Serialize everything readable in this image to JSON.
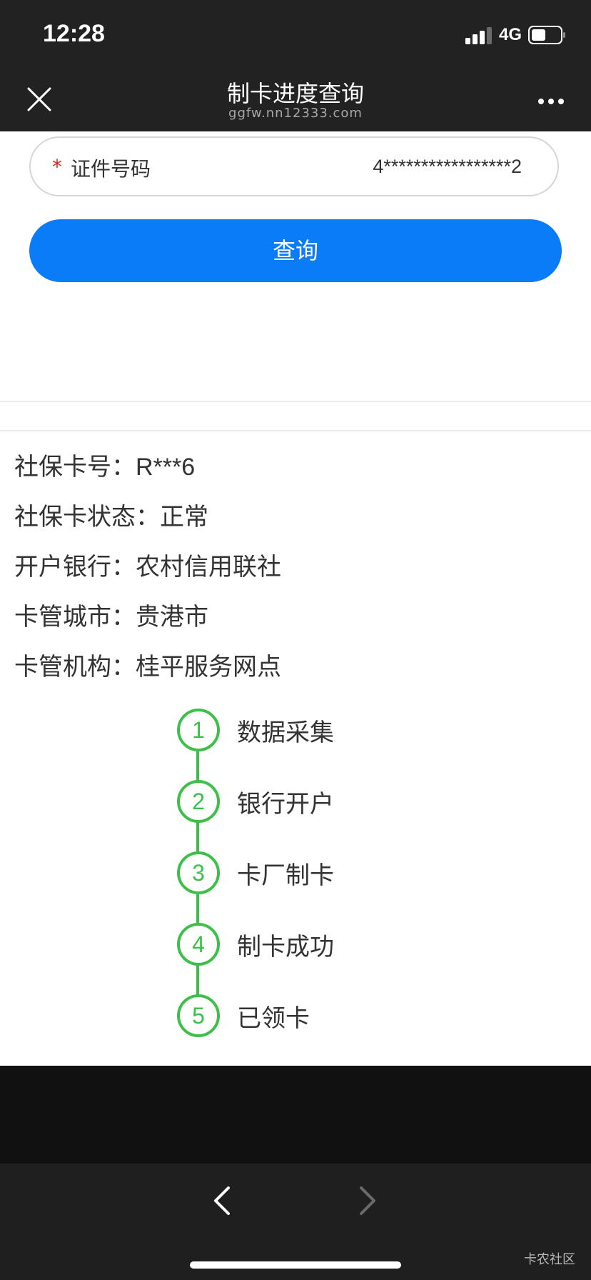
{
  "status_bar": {
    "time": "12:28",
    "network": "4G",
    "icons": [
      "signal-bars-icon",
      "battery-icon"
    ]
  },
  "nav": {
    "title": "制卡进度查询",
    "url": "ggfw.nn12333.com",
    "icons": [
      "close-icon",
      "more-icon"
    ]
  },
  "form": {
    "required_mark": "*",
    "id_label": "证件号码",
    "id_value": "4*****************2",
    "query_button": "查询"
  },
  "info": [
    {
      "label": "社保卡号：",
      "value": "R***6"
    },
    {
      "label": "社保卡状态：",
      "value": "正常"
    },
    {
      "label": "开户银行：",
      "value": "农村信用联社"
    },
    {
      "label": "卡管城市：",
      "value": "贵港市"
    },
    {
      "label": "卡管机构：",
      "value": "桂平服务网点"
    }
  ],
  "progress": {
    "color": "#3cc04a",
    "steps": [
      {
        "number": "1",
        "label": "数据采集"
      },
      {
        "number": "2",
        "label": "银行开户"
      },
      {
        "number": "3",
        "label": "卡厂制卡"
      },
      {
        "number": "4",
        "label": "制卡成功"
      },
      {
        "number": "5",
        "label": "已领卡"
      }
    ]
  },
  "toolbar": {
    "icons": [
      "back-icon",
      "forward-icon"
    ],
    "watermark": "卡农社区"
  },
  "colors": {
    "accent": "#0a7cf8",
    "required": "#e02020",
    "bar_background": "#222222"
  }
}
